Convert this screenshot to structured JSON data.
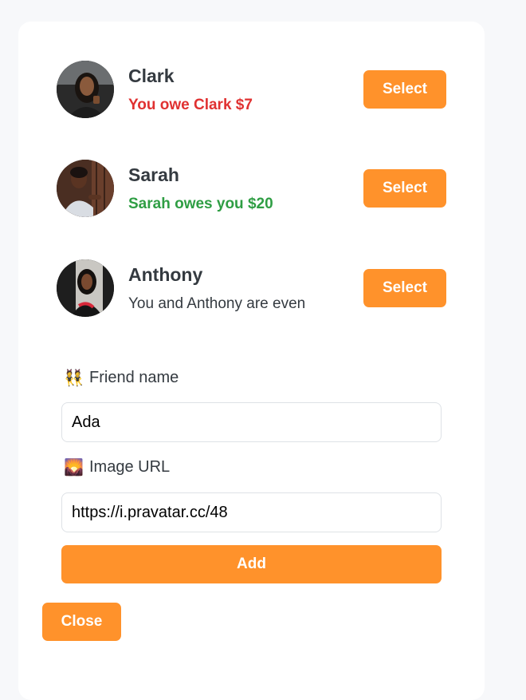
{
  "friends": [
    {
      "name": "Clark",
      "status": "You owe Clark $7",
      "status_type": "owe",
      "select_label": "Select"
    },
    {
      "name": "Sarah",
      "status": "Sarah owes you $20",
      "status_type": "owed",
      "select_label": "Select"
    },
    {
      "name": "Anthony",
      "status": "You and Anthony are even",
      "status_type": "even",
      "select_label": "Select"
    }
  ],
  "form": {
    "name_emoji": "👯",
    "name_label": "Friend name",
    "name_value": "Ada",
    "image_emoji": "🌄",
    "image_label": "Image URL",
    "image_value": "https://i.pravatar.cc/48",
    "add_label": "Add"
  },
  "close_label": "Close",
  "colors": {
    "accent": "#ff922b",
    "owe": "#e03131",
    "owed": "#2f9e44",
    "text": "#343a40"
  }
}
